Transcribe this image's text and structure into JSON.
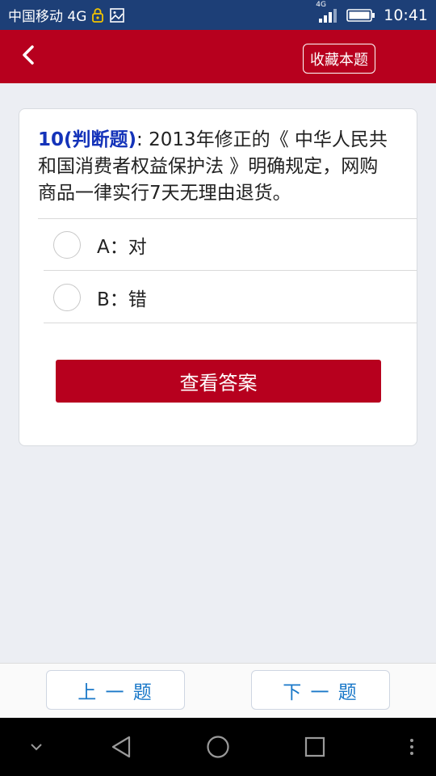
{
  "status_bar": {
    "carrier": "中国移动 4G",
    "network_badge": "4G",
    "time": "10:41",
    "icons": [
      "lock-icon",
      "image-icon",
      "signal-icon",
      "battery-icon"
    ]
  },
  "app_bar": {
    "back_icon": "chevron-left-icon",
    "favorite_label": "收藏本题"
  },
  "question": {
    "tag": "10(判断题)",
    "text": ": 2013年修正的《 中华人民共和国消费者权益保护法 》明确规定，网购商品一律实行7天无理由退货。",
    "options": [
      {
        "label": "A：对"
      },
      {
        "label": "B：错"
      }
    ],
    "show_answer_label": "查看答案"
  },
  "bottom_nav": {
    "prev_label": "上 一 题",
    "next_label": "下 一 题"
  },
  "colors": {
    "status_bar": "#1d3f77",
    "brand_red": "#b7001e",
    "tag_blue": "#1433b9",
    "nav_text_blue": "#1a78c8"
  },
  "system_nav": {
    "icons": [
      "chevron-down-icon",
      "back-triangle-icon",
      "home-circle-icon",
      "recents-square-icon",
      "more-dots-icon"
    ]
  }
}
